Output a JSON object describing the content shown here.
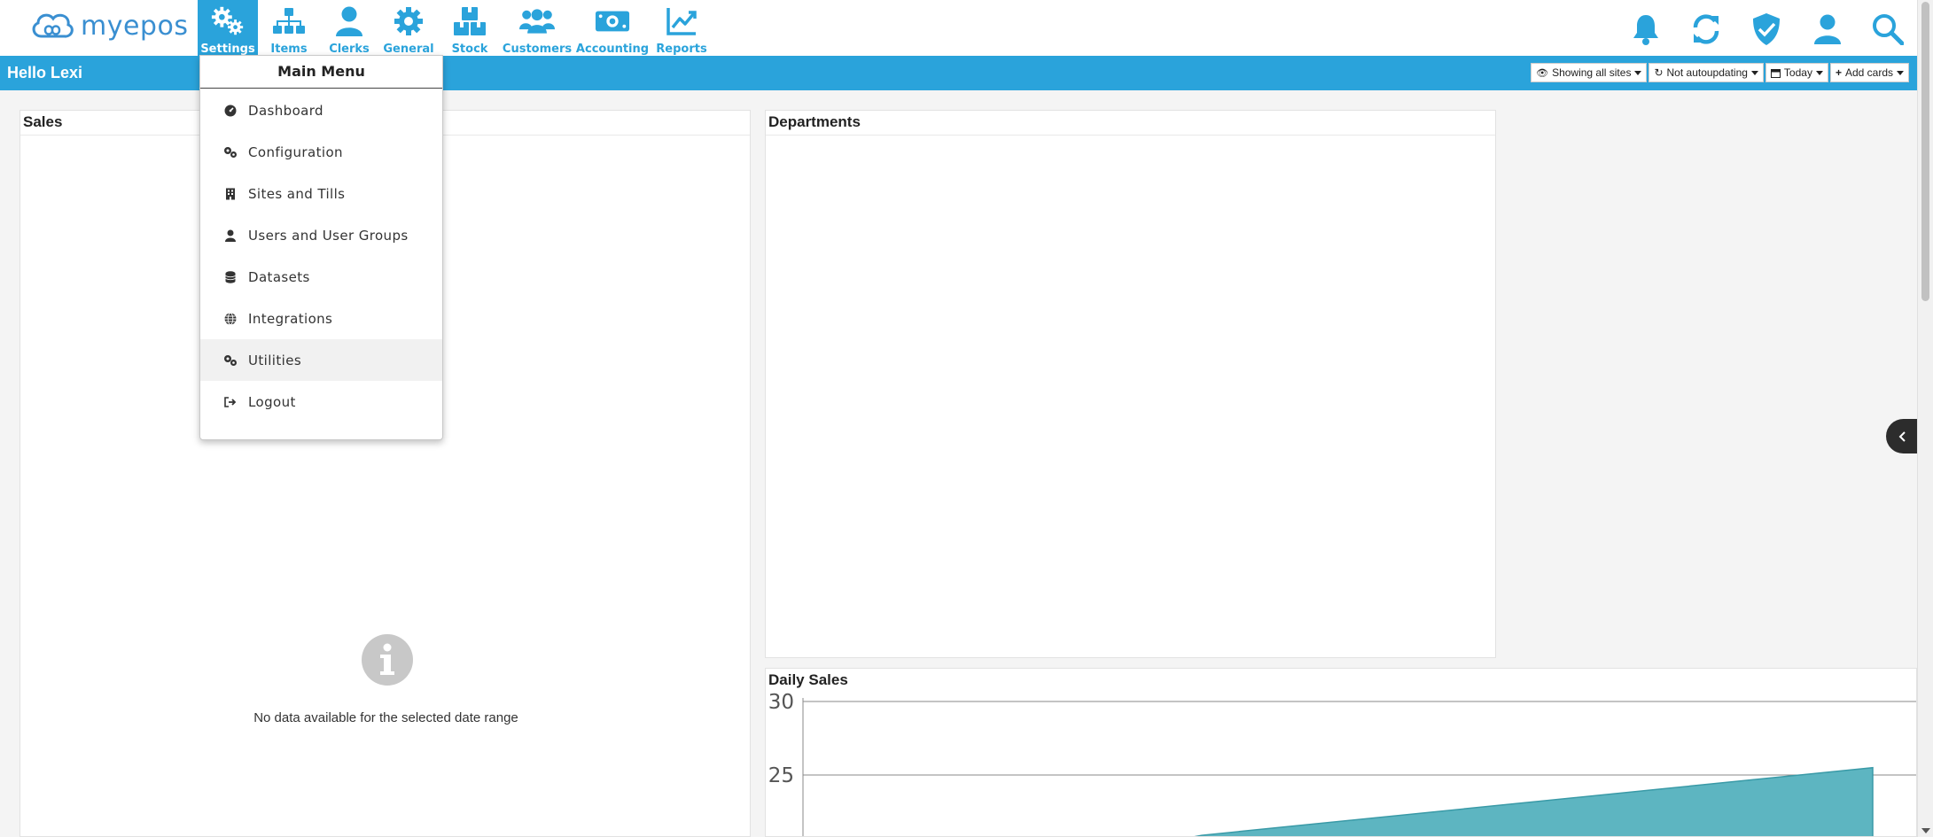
{
  "brand": {
    "logo_text": "myepos",
    "color": "#3a8fd1"
  },
  "colors": {
    "accent": "#2aa3db",
    "chart_fill": "#5db5c1",
    "chart_stroke": "#3a9aa7"
  },
  "nav": {
    "items": [
      {
        "label": "Settings",
        "icon": "gears-icon",
        "active": true
      },
      {
        "label": "Items",
        "icon": "sitemap-icon"
      },
      {
        "label": "Clerks",
        "icon": "user-icon"
      },
      {
        "label": "General",
        "icon": "gear-icon"
      },
      {
        "label": "Stock",
        "icon": "boxes-icon"
      },
      {
        "label": "Customers",
        "icon": "users-icon"
      },
      {
        "label": "Accounting",
        "icon": "money-icon"
      },
      {
        "label": "Reports",
        "icon": "chart-line-icon"
      }
    ],
    "right_icons": [
      "bell-icon",
      "refresh-icon",
      "shield-check-icon",
      "user-icon",
      "search-icon"
    ]
  },
  "header": {
    "greeting": "Hello Lexi",
    "toolbar": {
      "sites": "Showing all sites",
      "autoupdate": "Not autoupdating",
      "range": "Today",
      "add_cards": "Add cards"
    }
  },
  "menu": {
    "title": "Main Menu",
    "items": [
      {
        "label": "Dashboard",
        "icon": "tachometer-icon"
      },
      {
        "label": "Configuration",
        "icon": "cogs-icon"
      },
      {
        "label": "Sites and Tills",
        "icon": "building-icon"
      },
      {
        "label": "Users and User Groups",
        "icon": "user-icon"
      },
      {
        "label": "Datasets",
        "icon": "database-icon"
      },
      {
        "label": "Integrations",
        "icon": "globe-icon"
      },
      {
        "label": "Utilities",
        "icon": "cogs-icon",
        "hovered": true
      },
      {
        "label": "Logout",
        "icon": "sign-out-icon"
      }
    ]
  },
  "cards": {
    "sales": {
      "title": "Sales",
      "empty_text": "No data available for the selected date range"
    },
    "departments": {
      "title": "Departments"
    },
    "daily_sales": {
      "title": "Daily Sales"
    }
  },
  "chart_data": {
    "type": "area",
    "title": "Daily Sales",
    "xlabel": "",
    "ylabel": "",
    "y_ticks": [
      30,
      25
    ],
    "ylim": [
      20,
      30
    ],
    "grid": true,
    "series": [
      {
        "x": [
          0,
          1
        ],
        "values": [
          20.9,
          25.5
        ]
      }
    ]
  }
}
